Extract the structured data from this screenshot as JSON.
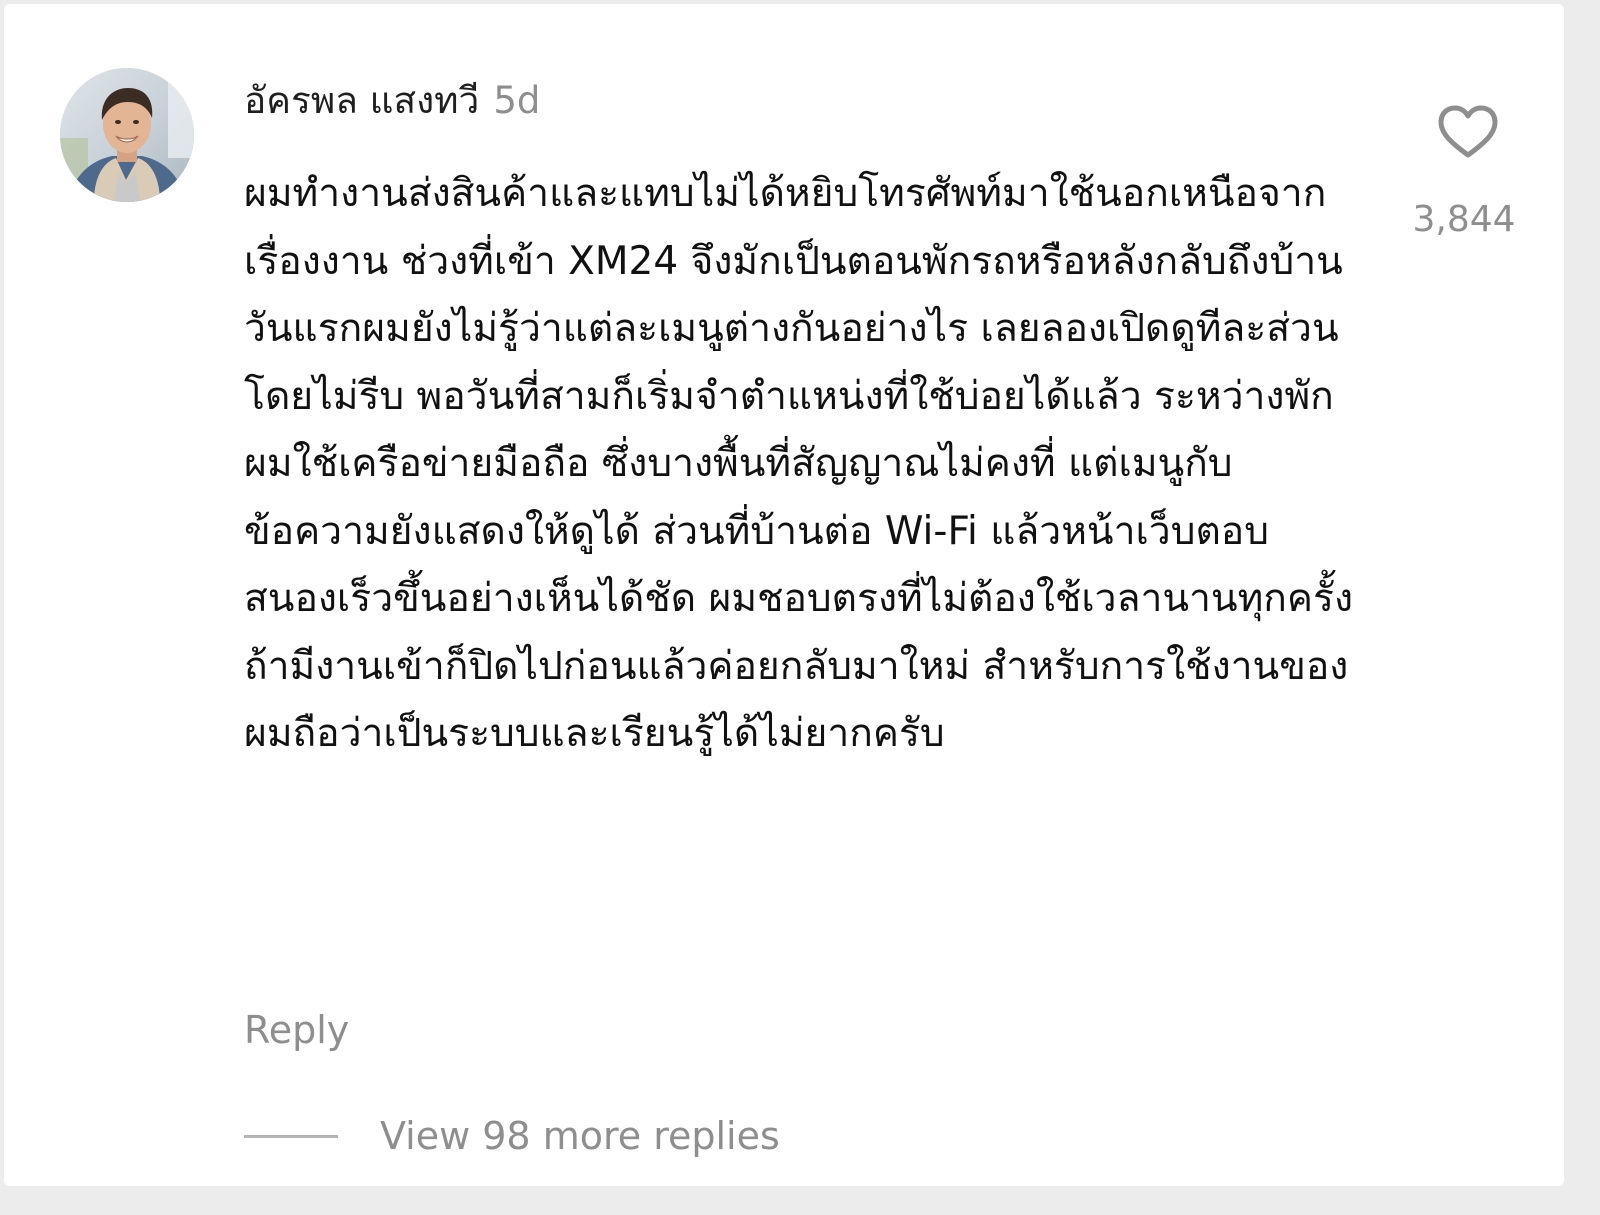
{
  "comment": {
    "avatar_icon": "user-photo-avatar",
    "username": "อัครพล แสงทวี",
    "timestamp": "5d",
    "text": "ผมทำงานส่งสินค้าและแทบไม่ได้หยิบโทรศัพท์มาใช้นอกเหนือจากเรื่องงาน ช่วงที่เข้า XM24 จึงมักเป็นตอนพักรถหรือหลังกลับถึงบ้าน วันแรกผมยังไม่รู้ว่าแต่ละเมนูต่างกันอย่างไร เลยลองเปิดดูทีละส่วนโดยไม่รีบ พอวันที่สามก็เริ่มจำตำแหน่งที่ใช้บ่อยได้แล้ว ระหว่างพักผมใช้เครือข่ายมือถือ ซึ่งบางพื้นที่สัญญาณไม่คงที่ แต่เมนูกับข้อความยังแสดงให้ดูได้ ส่วนที่บ้านต่อ Wi-Fi แล้วหน้าเว็บตอบสนองเร็วขึ้นอย่างเห็นได้ชัด ผมชอบตรงที่ไม่ต้องใช้เวลานานทุกครั้ง ถ้ามีงานเข้าก็ปิดไปก่อนแล้วค่อยกลับมาใหม่ สำหรับการใช้งานของผมถือว่าเป็นระบบและเรียนรู้ได้ไม่ยากครับ",
    "like_icon": "heart-outline-icon",
    "like_count": "3,844",
    "reply_label": "Reply",
    "view_replies_label": "View 98 more replies"
  },
  "colors": {
    "primary_text": "#111111",
    "secondary_text": "#8e8e8e",
    "background": "#ffffff",
    "page_background": "#ececec"
  }
}
